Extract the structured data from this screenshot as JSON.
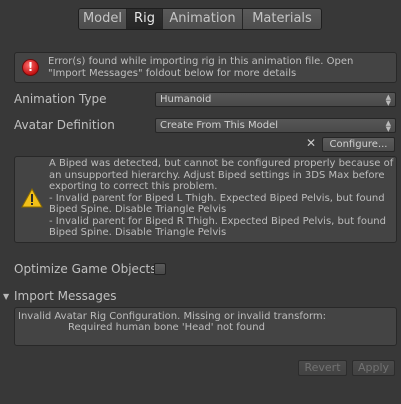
{
  "tabs": [
    {
      "label": "Model",
      "active": false
    },
    {
      "label": "Rig",
      "active": true
    },
    {
      "label": "Animation",
      "active": false
    },
    {
      "label": "Materials",
      "active": false
    }
  ],
  "error": {
    "icon": "error-icon",
    "text": "Error(s) found while importing rig in this animation file. Open \"Import Messages\" foldout below for more details"
  },
  "animation_type": {
    "label": "Animation Type",
    "value": "Humanoid"
  },
  "avatar_definition": {
    "label": "Avatar Definition",
    "value": "Create From This Model"
  },
  "configure": {
    "clear_glyph": "✕",
    "label": "Configure..."
  },
  "warning": {
    "icon": "warning-icon",
    "lines": [
      "A Biped was detected, but cannot be configured properly because of an unsupported hierarchy. Adjust Biped settings in 3DS Max before exporting to correct this problem.",
      "- Invalid parent for Biped L Thigh. Expected Biped Pelvis, but found Biped Spine. Disable Triangle Pelvis",
      "- Invalid parent for Biped R Thigh. Expected Biped Pelvis, but found Biped Spine. Disable Triangle Pelvis"
    ]
  },
  "optimize": {
    "label": "Optimize Game Objects",
    "checked": false
  },
  "import_messages": {
    "label": "Import Messages",
    "expanded": true,
    "line1": "Invalid Avatar Rig Configuration. Missing or invalid transform:",
    "line2": "Required human bone 'Head' not found"
  },
  "buttons": {
    "revert": "Revert",
    "apply": "Apply"
  }
}
